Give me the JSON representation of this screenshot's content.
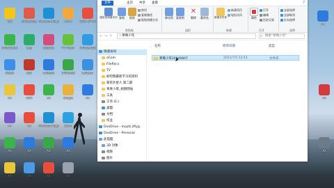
{
  "desktop_icons": [
    {
      "label": "QQ",
      "icon": "qq-penguin-icon",
      "color": "#f5c518"
    },
    {
      "label": "2020新版本",
      "icon": "folder-icon",
      "color": "#e05a4a"
    },
    {
      "label": "Microsoft Edge",
      "icon": "edge-icon",
      "color": "#1f8fd6"
    },
    {
      "label": "Kuwo",
      "icon": "music-icon",
      "color": "#f2a93b"
    },
    {
      "label": "2021-07-09",
      "icon": "document-icon",
      "color": "#e94e3d"
    },
    {
      "label": "360安全卫士",
      "icon": "shield-icon",
      "color": "#3bb54a"
    },
    {
      "label": "微信",
      "icon": "wechat-icon",
      "color": "#2aae67"
    },
    {
      "label": "家庭作业",
      "icon": "document-icon",
      "color": "#d44d7a"
    },
    {
      "label": "FV Player",
      "icon": "video-icon",
      "color": "#67c23a"
    },
    {
      "label": "360软件管家",
      "icon": "app-icon",
      "color": "#2f9be3"
    },
    {
      "label": "网易云",
      "icon": "app-icon",
      "color": "#3c8ee8"
    },
    {
      "label": "钉钉",
      "icon": "app-icon",
      "color": "#c0392b"
    },
    {
      "label": "腾讯会议",
      "icon": "app-icon",
      "color": "#2e7be0"
    },
    {
      "label": "360浏览器",
      "icon": "browser-icon",
      "color": "#3aa84a"
    },
    {
      "label": "腾讯课堂",
      "icon": "app-icon",
      "color": "#3d8fe0"
    },
    {
      "label": "XX",
      "icon": "app-icon",
      "color": "#e8c73a"
    },
    {
      "label": "WPS",
      "icon": "wps-icon",
      "color": "#e94e3d"
    },
    {
      "label": "XX",
      "icon": "app-icon",
      "color": "#3bb54a"
    },
    {
      "label": "Google",
      "icon": "chrome-icon",
      "color": "#e9b23a"
    },
    {
      "label": "XX",
      "icon": "app-icon",
      "color": "#2e7be0"
    },
    {
      "label": "XX",
      "icon": "app-icon",
      "color": "#7a5acb"
    },
    {
      "label": "XX",
      "icon": "app-icon",
      "color": "#e94e3d"
    },
    {
      "label": "Microsoft Edge",
      "icon": "edge-icon",
      "color": "#1f8fd6"
    },
    {
      "label": "Zoom",
      "icon": "app-icon",
      "color": "#2aa1e0"
    },
    {
      "label": "XX",
      "icon": "app-icon",
      "color": "#3bb54a"
    },
    {
      "label": "XX",
      "icon": "app-icon",
      "color": "#2e7be0"
    },
    {
      "label": "XX",
      "icon": "app-icon",
      "color": "#3aa84a"
    },
    {
      "label": "XX",
      "icon": "app-icon",
      "color": "#2e7be0"
    },
    {
      "label": "XX",
      "icon": "app-icon",
      "color": "#e8c73a"
    },
    {
      "label": "XX",
      "icon": "app-icon",
      "color": "#4c9be8"
    },
    {
      "label": "XX",
      "icon": "app-icon",
      "color": "#e94e3d"
    },
    {
      "label": "XX",
      "icon": "app-icon",
      "color": "#9aa3ad"
    }
  ],
  "right_icons": [
    {
      "label": "XX",
      "icon": "app-icon",
      "color": "#2e7be0"
    },
    {
      "label": "XX",
      "icon": "app-icon",
      "color": "#d23c3c"
    },
    {
      "label": "XX",
      "icon": "app-icon",
      "color": "#6c7a89"
    }
  ],
  "explorer": {
    "tabs": [
      "文件",
      "主页",
      "共享",
      "查看"
    ],
    "ribbon": {
      "pin_label": "固定到快速访问",
      "copy_label": "复制",
      "paste_label": "粘贴",
      "cut_label": "剪切",
      "copy_path_label": "复制路径",
      "paste_shortcut_label": "粘贴快捷方式",
      "move_to_label": "移动到",
      "copy_to_label": "复制到",
      "delete_label": "删除",
      "rename_label": "重命名",
      "new_folder_label": "新建文件夹",
      "new_item_label": "新建项目",
      "easy_access_label": "轻松访问",
      "properties_label": "属性",
      "open_label": "打开",
      "edit_label": "编辑",
      "history_label": "历史记录",
      "select_all_label": "全部选择",
      "select_none_label": "全部取消",
      "invert_label": "反向选择",
      "group_clipboard": "剪贴板",
      "group_organize": "组织",
      "group_new": "新建",
      "group_open": "打开",
      "group_select": "选择"
    },
    "address": "› 草莓少年",
    "search_placeholder": "搜索\"草莓少年\"",
    "nav": [
      "快速访问",
      "oCam",
      "FileRecv",
      "TV",
      "如何我最新学习的资料",
      "家有外星人 第二部",
      "青青小草_视频网站",
      "工具",
      "工作 (E:)",
      "桌面",
      "文档",
      "作业",
      "OneDrive - mojds.zftyg",
      "OneDrive - Personal",
      "此电脑",
      "3D 对象",
      "视频",
      "图片"
    ],
    "columns": {
      "name": "名称",
      "date": "修改日期",
      "type": "类型"
    },
    "files": [
      {
        "name": "草莓少年20640607",
        "date": "2021/7/5 12:43",
        "type": "文件夹"
      }
    ]
  }
}
